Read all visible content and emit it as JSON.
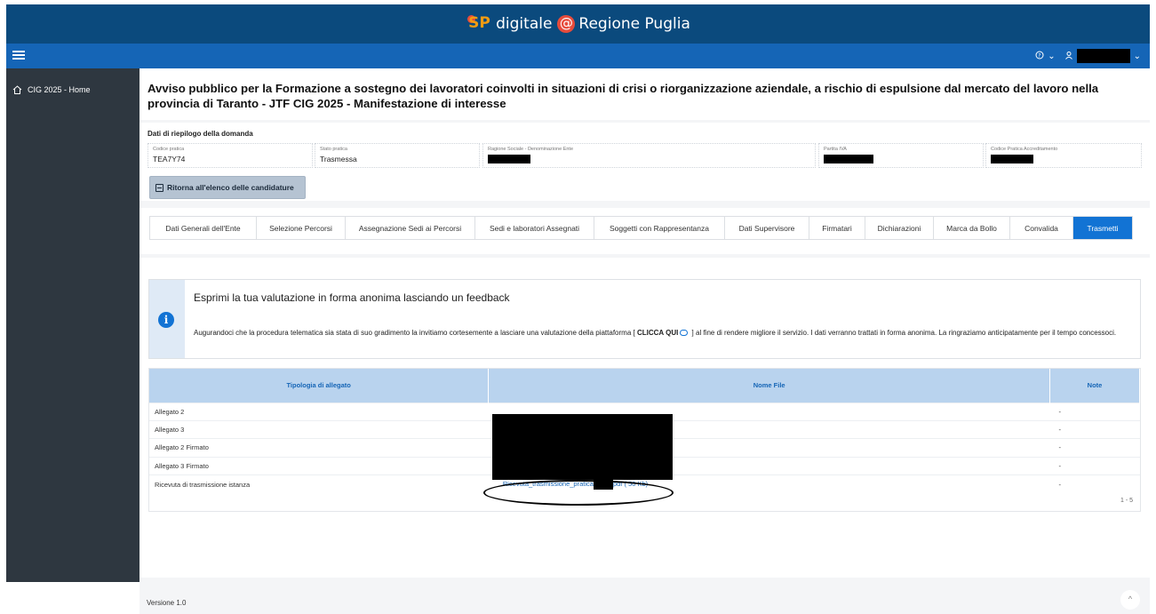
{
  "header": {
    "brand_sp": "SP",
    "brand_name": "digitale",
    "brand_at": "@",
    "brand_region": "Regione Puglia"
  },
  "navbar": {
    "help_label": "?",
    "chevron": "⌄"
  },
  "sidebar": {
    "items": [
      {
        "label": "CIG 2025 - Home",
        "icon": "home-icon"
      }
    ]
  },
  "main": {
    "title": "Avviso pubblico per la Formazione a sostegno dei lavoratori coinvolti in situazioni di crisi o riorganizzazione aziendale, a rischio di espulsione dal mercato del lavoro nella provincia di Taranto - JTF CIG 2025 - Manifestazione di interesse",
    "summary": {
      "heading": "Dati di riepilogo della domanda",
      "fields": [
        {
          "label": "Codice pratica",
          "value": "TEA7Y74"
        },
        {
          "label": "Stato pratica",
          "value": "Trasmessa"
        },
        {
          "label": "Ragione Sociale - Denominazione Ente",
          "value": ""
        },
        {
          "label": "Partita IVA",
          "value": ""
        },
        {
          "label": "Codice Pratica Accreditamento",
          "value": ""
        }
      ],
      "back_button": "Ritorna all'elenco delle candidature"
    },
    "tabs": [
      "Dati Generali dell'Ente",
      "Selezione Percorsi",
      "Assegnazione Sedi ai Percorsi",
      "Sedi e laboratori Assegnati",
      "Soggetti con Rappresentanza",
      "Dati Supervisore",
      "Firmatari",
      "Dichiarazioni",
      "Marca da Bollo",
      "Convalida",
      "Trasmetti"
    ],
    "active_tab": "Trasmetti",
    "feedback": {
      "title": "Esprimi la tua valutazione in forma anonima lasciando un feedback",
      "text_before": "Augurandoci che la procedura telematica sia stata di suo gradimento la invitiamo cortesemente a lasciare una valutazione della piattaforma [ ",
      "link": "CLICCA QUI",
      "text_after": " ] al fine di rendere migliore il servizio. I dati verranno trattati in forma anonima. La ringraziamo anticipatamente per il tempo concessoci."
    },
    "table": {
      "headers": [
        "Tipologia di allegato",
        "Nome File",
        "Note"
      ],
      "rows": [
        {
          "type": "Allegato 2",
          "file": "",
          "note": "-"
        },
        {
          "type": "Allegato 3",
          "file": "",
          "note": "-"
        },
        {
          "type": "Allegato 2 Firmato",
          "file": "",
          "note": "-"
        },
        {
          "type": "Allegato 3 Firmato",
          "file": "",
          "note": "-"
        },
        {
          "type": "Ricevuta di trasmissione istanza",
          "file_prefix": "Ricevuta_trasmissione_pratica",
          "file_suffix": "pdf ( 50 Kb)",
          "note": "-"
        }
      ],
      "pager": "1 - 5"
    }
  },
  "footer": {
    "version": "Versione 1.0",
    "scroll_top": "^"
  },
  "colors": {
    "topbar": "#0b4a7d",
    "navbar": "#1565b6",
    "sidebar": "#2e3740",
    "accent": "#1273d4",
    "table_header": "#b9d3ee"
  }
}
